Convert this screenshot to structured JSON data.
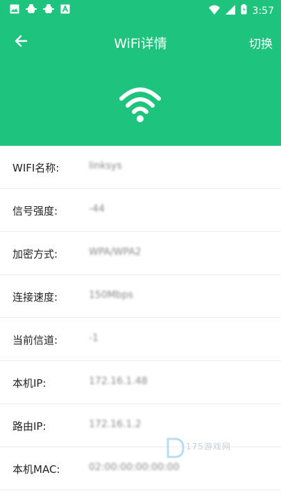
{
  "status_bar": {
    "time": "3:57",
    "left_icons": [
      "image-icon",
      "bug-icon",
      "bug-icon",
      "a-icon"
    ],
    "right_icons": [
      "wifi-icon",
      "signal-icon",
      "battery-icon"
    ]
  },
  "toolbar": {
    "title": "WiFi详情",
    "switch_label": "切换"
  },
  "colors": {
    "accent": "#1ec47e"
  },
  "details": [
    {
      "label": "WIFI名称:",
      "value": "linksys"
    },
    {
      "label": "信号强度:",
      "value": "-44"
    },
    {
      "label": "加密方式:",
      "value": "WPA/WPA2"
    },
    {
      "label": "连接速度:",
      "value": "150Mbps"
    },
    {
      "label": "当前信道:",
      "value": "-1"
    },
    {
      "label": "本机IP:",
      "value": "172.16.1.48"
    },
    {
      "label": "路由IP:",
      "value": "172.16.1.2"
    },
    {
      "label": "本机MAC:",
      "value": "02:00:00:00:00:00"
    }
  ],
  "watermark": {
    "text": "175游戏网"
  }
}
